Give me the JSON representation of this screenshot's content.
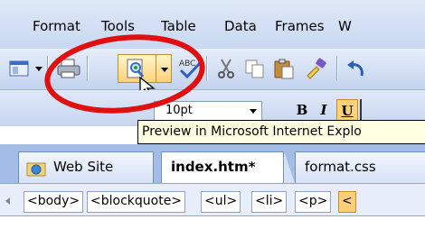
{
  "menu": {
    "items": [
      {
        "label": "Format"
      },
      {
        "label": "Tools"
      },
      {
        "label": "Table"
      },
      {
        "label": "Data"
      },
      {
        "label": "Frames"
      },
      {
        "label": "W"
      }
    ]
  },
  "toolbar1": {
    "icons": [
      "new-page-icon",
      "print-icon",
      "preview-in-browser-icon",
      "spelling-icon",
      "cut-icon",
      "copy-icon",
      "paste-icon",
      "format-painter-icon",
      "undo-icon"
    ]
  },
  "toolbar2": {
    "font_size": "10pt",
    "bold_label": "B",
    "italic_label": "I",
    "underline_label": "U"
  },
  "tooltip": {
    "text": "Preview in Microsoft Internet Explo"
  },
  "tabs": [
    {
      "label": "Web Site",
      "icon": "folder-web-icon"
    },
    {
      "label": "index.htm*",
      "active": true
    },
    {
      "label": "format.css"
    }
  ],
  "tag_selector": {
    "tags": [
      "<body>",
      "<blockquote>",
      "<ul>",
      "<li>",
      "<p>",
      "<"
    ]
  },
  "colors": {
    "highlight": "#e01010",
    "tooltip_bg": "#ffffe1",
    "active_button": "#ffd27a"
  }
}
